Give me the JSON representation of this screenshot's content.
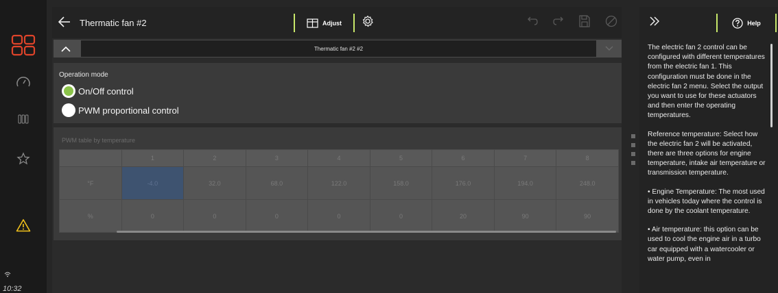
{
  "status": {
    "time": "10:32"
  },
  "header": {
    "title": "Thermatic fan #2",
    "adjust_label": "Adjust",
    "selector_value": "Thermatic fan #2 #2"
  },
  "operation_mode": {
    "label": "Operation mode",
    "options": [
      {
        "label": "On/Off control",
        "selected": true
      },
      {
        "label": "PWM proportional control",
        "selected": false
      }
    ]
  },
  "pwm_table": {
    "label": "PWM table by temperature",
    "columns": [
      "1",
      "2",
      "3",
      "4",
      "5",
      "6",
      "7",
      "8"
    ],
    "rows": [
      {
        "label": "°F",
        "cells": [
          "-4.0",
          "32.0",
          "68.0",
          "122.0",
          "158.0",
          "176.0",
          "194.0",
          "248.0"
        ]
      },
      {
        "label": "%",
        "cells": [
          "0",
          "0",
          "0",
          "0",
          "0",
          "20",
          "90",
          "90"
        ]
      }
    ]
  },
  "help": {
    "button_label": "Help",
    "paragraphs": [
      "The electric fan 2 control can be configured with different temperatures from the electric fan 1. This configuration must be done in the electric fan 2 menu. Select the output you want to use for these actuators and then enter the operating temperatures.",
      "Reference temperature: Select how the electric fan 2 will be activated, there are three options for engine temperature, intake air temperature or transmission temperature.",
      "• Engine Temperature: The most used in vehicles today where the control is done by the coolant temperature.",
      "• Air temperature: this option can be used to cool the engine air in a turbo car equipped with a watercooler or water pump, even in"
    ]
  },
  "colors": {
    "accent": "#c8e86a",
    "brand": "#e0442a",
    "warning": "#f2c21b",
    "radio_on": "#8bc34a"
  }
}
